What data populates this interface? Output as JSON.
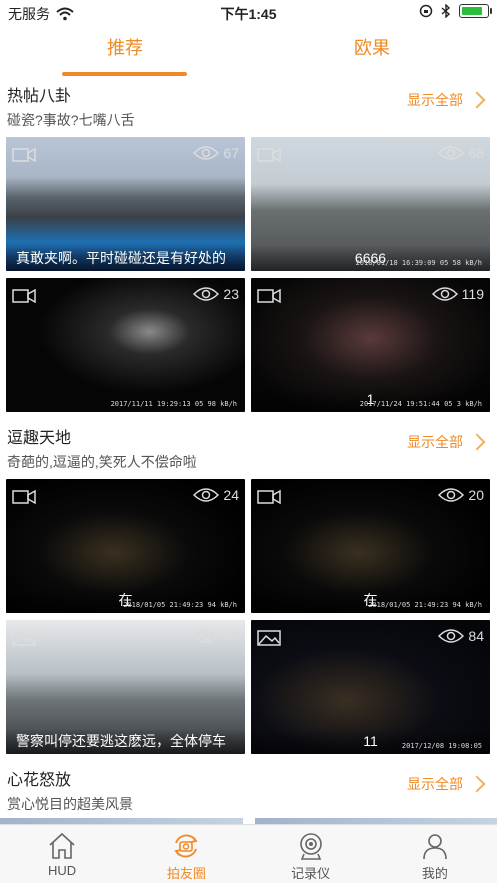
{
  "status": {
    "carrier": "无服务",
    "time": "下午1:45",
    "battery_level": 0.8
  },
  "top_tabs": [
    {
      "label": "推荐",
      "active": true
    },
    {
      "label": "欧果",
      "active": false
    }
  ],
  "sections": [
    {
      "title": "热帖八卦",
      "subtitle": "碰瓷?事故?七嘴八舌",
      "show_all": "显示全部",
      "items": [
        {
          "views": "67",
          "caption": "真敢夹啊。平时碰碰还是有好处的",
          "stamp": ""
        },
        {
          "views": "68",
          "caption": "6666",
          "stamp": "2018/01/18 16:39:09 05 58 kB/h"
        },
        {
          "views": "23",
          "caption": "",
          "stamp": "2017/11/11 19:29:13 05 98 kB/h"
        },
        {
          "views": "119",
          "caption": "1",
          "stamp": "2017/11/24 19:51:44 05 3 kB/h"
        }
      ]
    },
    {
      "title": "逗趣天地",
      "subtitle": "奇葩的,逗逼的,笑死人不偿命啦",
      "show_all": "显示全部",
      "items": [
        {
          "views": "24",
          "caption": "在",
          "stamp": "2018/01/05 21:49:23 94 kB/h"
        },
        {
          "views": "20",
          "caption": "在",
          "stamp": "2018/01/05 21:49:23 94 kB/h"
        },
        {
          "views": "44",
          "caption": "警察叫停还要逃这麽远，全体停车",
          "stamp": ""
        },
        {
          "views": "84",
          "caption": "11",
          "stamp": "2017/12/08 19:08:05"
        }
      ]
    },
    {
      "title": "心花怒放",
      "subtitle": "赏心悦目的超美风景",
      "show_all": "显示全部"
    }
  ],
  "tabbar": [
    {
      "label": "HUD",
      "icon": "home-icon",
      "active": false
    },
    {
      "label": "拍友圈",
      "icon": "camera-refresh-icon",
      "active": true
    },
    {
      "label": "记录仪",
      "icon": "dashcam-icon",
      "active": false
    },
    {
      "label": "我的",
      "icon": "user-icon",
      "active": false
    }
  ],
  "colors": {
    "accent": "#f08a24",
    "active_green_battery": "#2bbd3b"
  }
}
